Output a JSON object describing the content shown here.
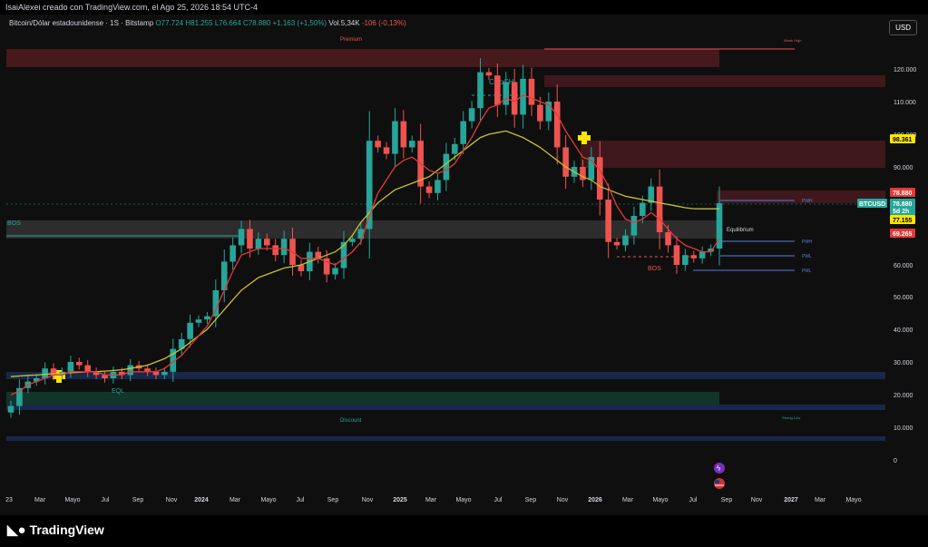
{
  "caption": "IsaiAlexei creado con TradingView.com, el Ago 25, 2026 18:54 UTC-4",
  "symbol": {
    "name": "Bitcoin/Dólar estadounidense · 1S · Bitstamp",
    "open": "O77.724",
    "high": "H81.255",
    "low": "L76.664",
    "close": "C78.880",
    "change": "+1.163 (+1,50%)",
    "volume": "Vol.5,34K",
    "vol_change": "-106 (-0,13%)"
  },
  "currency_button": "USD",
  "brand": "TradingView",
  "colors": {
    "up": "#26a69a",
    "down": "#ef5350",
    "ema_fast": "#e53935",
    "ema_slow": "#c8c030",
    "premium_zone": "#5a1d22",
    "discount_zone": "#123a2c",
    "blue_zone": "#1b2a52",
    "equilibrium": "#3a3a3a"
  },
  "zone_labels": {
    "premium": "Premium",
    "discount": "Discount",
    "equilibrium": "Equilibrium",
    "weak_high": "Weak High",
    "strong_low": "Strong Low",
    "choch": "CHoCH",
    "bos": "BOS",
    "bos_left": "BOS",
    "eql": "EQL",
    "pwh": "PWH",
    "pmh": "PMH",
    "pwl": "PWL",
    "pml": "PML"
  },
  "price_tags": [
    {
      "value": "98.361",
      "bg": "#ffe600",
      "fg": "#000"
    },
    {
      "value": "78.880",
      "bg": "#e53935",
      "fg": "#fff"
    },
    {
      "value": "78.880",
      "bg": "#26a69a",
      "fg": "#fff"
    },
    {
      "value": "5d 2h",
      "bg": "#26a69a",
      "fg": "#fff"
    },
    {
      "value": "77.155",
      "bg": "#ffe600",
      "fg": "#000"
    },
    {
      "value": "69.265",
      "bg": "#e53935",
      "fg": "#fff"
    }
  ],
  "ticker_tag": "BTCUSD",
  "chart_data": {
    "type": "candlestick",
    "y_ticks": [
      0,
      10,
      20,
      30,
      40,
      50,
      60,
      90,
      100,
      110,
      120
    ],
    "y_tick_labels": [
      "0",
      "10.000",
      "20.000",
      "30.000",
      "40.000",
      "50.000",
      "60.000",
      "90.000",
      "100.000",
      "110.000",
      "120.000"
    ],
    "ylim": [
      -5,
      130
    ],
    "x_tick_labels": [
      "23",
      "Mar",
      "Mayo",
      "Jul",
      "Sep",
      "Nov",
      "2024",
      "Mar",
      "Mayo",
      "Jul",
      "Sep",
      "Nov",
      "2025",
      "Mar",
      "Mayo",
      "Jul",
      "Sep",
      "Nov",
      "2026",
      "Mar",
      "Mayo",
      "Jul",
      "Sep",
      "Nov",
      "2027",
      "Mar",
      "Mayo"
    ],
    "x_tick_bold": [
      "2024",
      "2025",
      "2026",
      "2027"
    ],
    "close_path": [
      16.5,
      22,
      24,
      25,
      28,
      26,
      27,
      30,
      29,
      27,
      26,
      25,
      27,
      26,
      29,
      28,
      27,
      26,
      27,
      34,
      37,
      42,
      43,
      44,
      52,
      61,
      66,
      71,
      65,
      68,
      66,
      63,
      68,
      60,
      58,
      64,
      62,
      57,
      59,
      67,
      68,
      71,
      98,
      96,
      94,
      104,
      96,
      98,
      84,
      82,
      86,
      94,
      97,
      104,
      108,
      119,
      118,
      109,
      116,
      106,
      117,
      109,
      104,
      110,
      96,
      87,
      90,
      86,
      93,
      80,
      67,
      66,
      69,
      75,
      79,
      84,
      70,
      66,
      60,
      63,
      62,
      64,
      65,
      78.88
    ],
    "ema_fast": [
      20,
      21,
      23,
      24,
      25,
      26,
      26,
      27,
      27,
      27,
      27,
      26,
      26,
      26,
      27,
      27,
      27,
      27,
      28,
      30,
      32,
      35,
      38,
      41,
      46,
      52,
      58,
      63,
      64,
      65,
      65,
      65,
      65,
      64,
      62,
      62,
      62,
      61,
      60,
      62,
      64,
      67,
      75,
      82,
      86,
      90,
      92,
      93,
      91,
      89,
      88,
      89,
      91,
      95,
      99,
      104,
      108,
      109,
      111,
      110,
      112,
      111,
      110,
      109,
      106,
      101,
      97,
      93,
      92,
      89,
      84,
      78,
      74,
      73,
      74,
      76,
      74,
      71,
      68,
      66,
      65,
      64,
      64,
      68
    ],
    "ema_slow": [
      25.5,
      25.7,
      25.9,
      26,
      26.2,
      26.4,
      26.5,
      26.7,
      26.8,
      27,
      27,
      27.2,
      27.4,
      27.6,
      28,
      28.5,
      29,
      30,
      31,
      32.5,
      34,
      36,
      38,
      40,
      43,
      46,
      49,
      52,
      54,
      56,
      57,
      58,
      59,
      59.5,
      60,
      61,
      62,
      63,
      64,
      66,
      69,
      73,
      76,
      79,
      81,
      83,
      84,
      85,
      86,
      87,
      89,
      91,
      93,
      95,
      97,
      99,
      100,
      100.5,
      101,
      100,
      99,
      97.5,
      96,
      94,
      92,
      90,
      88.5,
      87,
      86,
      84,
      83,
      82,
      81,
      80.5,
      80,
      79.5,
      79,
      78.5,
      78,
      77.5,
      77.2,
      77.155,
      77.155,
      77.155
    ]
  }
}
